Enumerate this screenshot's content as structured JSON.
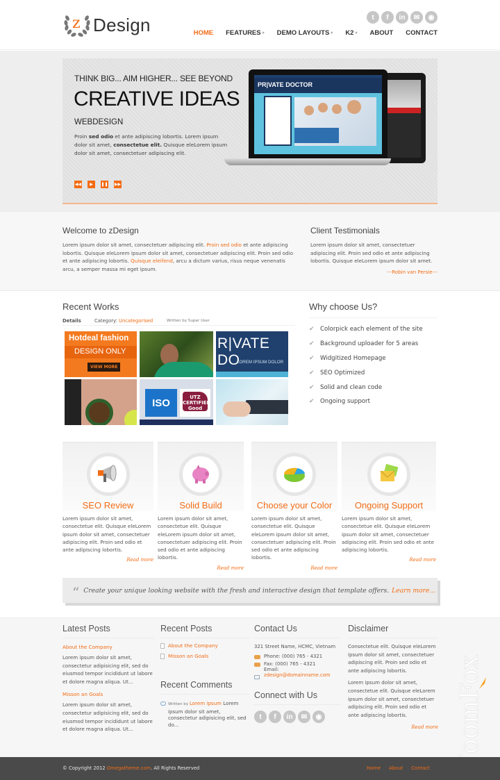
{
  "header": {
    "logo_mark": "z",
    "logo_text": "Design",
    "social": [
      {
        "icon": "twitter-icon",
        "glyph": "t"
      },
      {
        "icon": "facebook-icon",
        "glyph": "f"
      },
      {
        "icon": "linkedin-icon",
        "glyph": "in"
      },
      {
        "icon": "email-icon",
        "glyph": "✉"
      },
      {
        "icon": "rss-icon",
        "glyph": "◉"
      }
    ],
    "nav": [
      {
        "label": "HOME",
        "active": true,
        "dropdown": false
      },
      {
        "label": "FEATURES",
        "active": false,
        "dropdown": true
      },
      {
        "label": "DEMO LAYOUTS",
        "active": false,
        "dropdown": true
      },
      {
        "label": "K2",
        "active": false,
        "dropdown": true
      },
      {
        "label": "ABOUT",
        "active": false,
        "dropdown": false
      },
      {
        "label": "CONTACT",
        "active": false,
        "dropdown": false
      }
    ]
  },
  "slider": {
    "subtitle": "THINK BIG... AIM HIGHER... SEE BEYOND",
    "title": "CREATIVE IDEAS",
    "category": "WEBDESIGN",
    "text_parts": [
      "Proin ",
      "sed odio",
      " et ante adipiscing lobortis. Lorem ipsum dolor sit amet, ",
      "consectetue elit.",
      " Quisque eleLorem ipsum dolor sit amet, consectetuer adipiscing elit."
    ],
    "controls": [
      "first",
      "play",
      "pause",
      "last"
    ],
    "screen_logo": "PR|VATE DOCTOR"
  },
  "welcome": {
    "title": "Welcome to zDesign",
    "text_parts": [
      "Lorem ipsum dolor sit amet, consectetuer adipiscing elit. ",
      "Proin sed odio",
      " et ante adipiscing lobortis. Quisque eleLorem ipsum dolor sit amet, consectetuer adipiscing elit. Proin sed odio et ante adipiscing lobortis. ",
      "Quisque eleifend",
      ", arcu a dictum varius, risus neque venenatis arcu, a semper massa mi eget ipsum."
    ]
  },
  "testimonial": {
    "title": "Client Testimonials",
    "text": "Lorem ipsum dolor sit amet, consectetuer adipiscing elit. Proin sed odio et ante adipiscing lobortis. Quisque eleLorem ipsum dolor sit amet.",
    "author": "---Robin van Persie---"
  },
  "recent_works": {
    "title": "Recent Works",
    "details_label": "Details",
    "category_label": "Category: ",
    "category_value": "Uncategorised",
    "written_by": "Written by Super User",
    "items": [
      {
        "line1": "Hotdeal fashion",
        "line2": "DESIGN ONLY",
        "button": "VIEW MORE"
      },
      {
        "alt": "woman-in-forest-photo"
      },
      {
        "line1": "R|VATE DO",
        "line2": "LOREM IPSUM DOLOR"
      },
      {
        "alt": "coffee-cup-photo"
      },
      {
        "line1": "ISO",
        "line2": "UTZ CERTIFIED Good inside"
      },
      {
        "alt": "keyboard-mouse-photo"
      }
    ]
  },
  "why_choose": {
    "title": "Why choose Us?",
    "items": [
      "Colorpick each element of the site",
      "Background uploader for 5 areas",
      "Widgitized Homepage",
      "SEO Optimized",
      "Solid and clean code",
      "Ongoing support"
    ]
  },
  "features": [
    {
      "title": "SEO Review",
      "icon": "megaphone-icon",
      "text": "Lorem ipsum dolor sit amet, consectetue elit. Quisque eleLorem ipsum dolor sit amet, consectetuer adipiscing elit. Proin sed odio et ante adipiscing lobortis.",
      "more": "Read more"
    },
    {
      "title": "Solid Build",
      "icon": "piggy-bank-icon",
      "text": "Lorem ipsum dolor sit amet, consectetue elit. Quisque eleLorem ipsum dolor sit amet, consectetuer adipiscing elit. Proin sed odio et ante adipiscing lobortis.",
      "more": "Read more"
    },
    {
      "title": "Choose your Color",
      "icon": "pie-chart-icon",
      "text": "Lorem ipsum dolor sit amet, consectetue elit. Quisque eleLorem ipsum dolor sit amet, consectetuer adipiscing elit. Proin sed odio et ante adipiscing lobortis.",
      "more": "Read more"
    },
    {
      "title": "Ongoing Support",
      "icon": "envelopes-icon",
      "text": "Lorem ipsum dolor sit amet, consectetue elit. Quisque eleLorem ipsum dolor sit amet, consectetuer adipiscing elit. Proin sed odio et ante adipiscing lobortis.",
      "more": "Read more"
    }
  ],
  "quote": {
    "text": "Create your unique looking website with the fresh and interactive design that template offers.",
    "link": "Learn more..."
  },
  "footer": {
    "latest_posts": {
      "title": "Latest Posts",
      "posts": [
        {
          "title": "About the Company",
          "text": "Lorem ipsum dolor sit amet, consectetur adipisicing elit, sed do eiusmod tempor incididunt ut labore et dolore magna aliqua. Ut..."
        },
        {
          "title": "Misson an Goals",
          "text": "Lorem ipsum dolor sit amet, consectetur adipisicing elit, sed do eiusmod tempor incididunt ut labore et dolore magna aliqua. Ut..."
        }
      ]
    },
    "recent_posts": {
      "title": "Recent Posts",
      "items": [
        "About the Company",
        "Misson an Goals"
      ]
    },
    "recent_comments": {
      "title": "Recent Comments",
      "by_label": "Written by ",
      "author": "Lorem ipsum",
      "text": " Lorem ipsum dolor sit amet, consectetur adipisicing elit, sed do..."
    },
    "contact": {
      "title": "Contact Us",
      "address": "321 Street Name, HCMC, Vietnam",
      "phone": "Phone: (000) 765 - 4321",
      "fax": "Fax: (000) 765 - 4321",
      "email_label": "Email:",
      "email": "zdesign@domainname.com"
    },
    "connect": {
      "title": "Connect with Us",
      "social": [
        {
          "icon": "twitter-icon",
          "glyph": "t"
        },
        {
          "icon": "facebook-icon",
          "glyph": "f"
        },
        {
          "icon": "linkedin-icon",
          "glyph": "in"
        },
        {
          "icon": "email-icon",
          "glyph": "✉"
        },
        {
          "icon": "rss-icon",
          "glyph": "◉"
        }
      ]
    },
    "disclaimer": {
      "title": "Disclaimer",
      "p1": "Consectetue elit. Quisque eleLorem ipsum dolor sit amet, consectetuer adipiscing elit. Proin sed odio et ante adipiscing lobortis.",
      "p2": "Lorem ipsum dolor sit amet, consectetue elit. Quisque eleLorem ipsum dolor sit amet, consectetuer adipiscing elit. Proin sed odio et ante adipiscing lobortis.",
      "more": "Read more"
    },
    "watermark": "JoomFox"
  },
  "bottom_bar": {
    "copyright_prefix": "© Copyright 2012 ",
    "copyright_link": "Omegatheme.com",
    "copyright_suffix": ". All Rights Reserved",
    "nav": [
      "Home",
      "About",
      "Contact"
    ]
  },
  "colors": {
    "accent": "#f26c15",
    "text": "#555555",
    "footer_bar": "#4a4a4a"
  }
}
